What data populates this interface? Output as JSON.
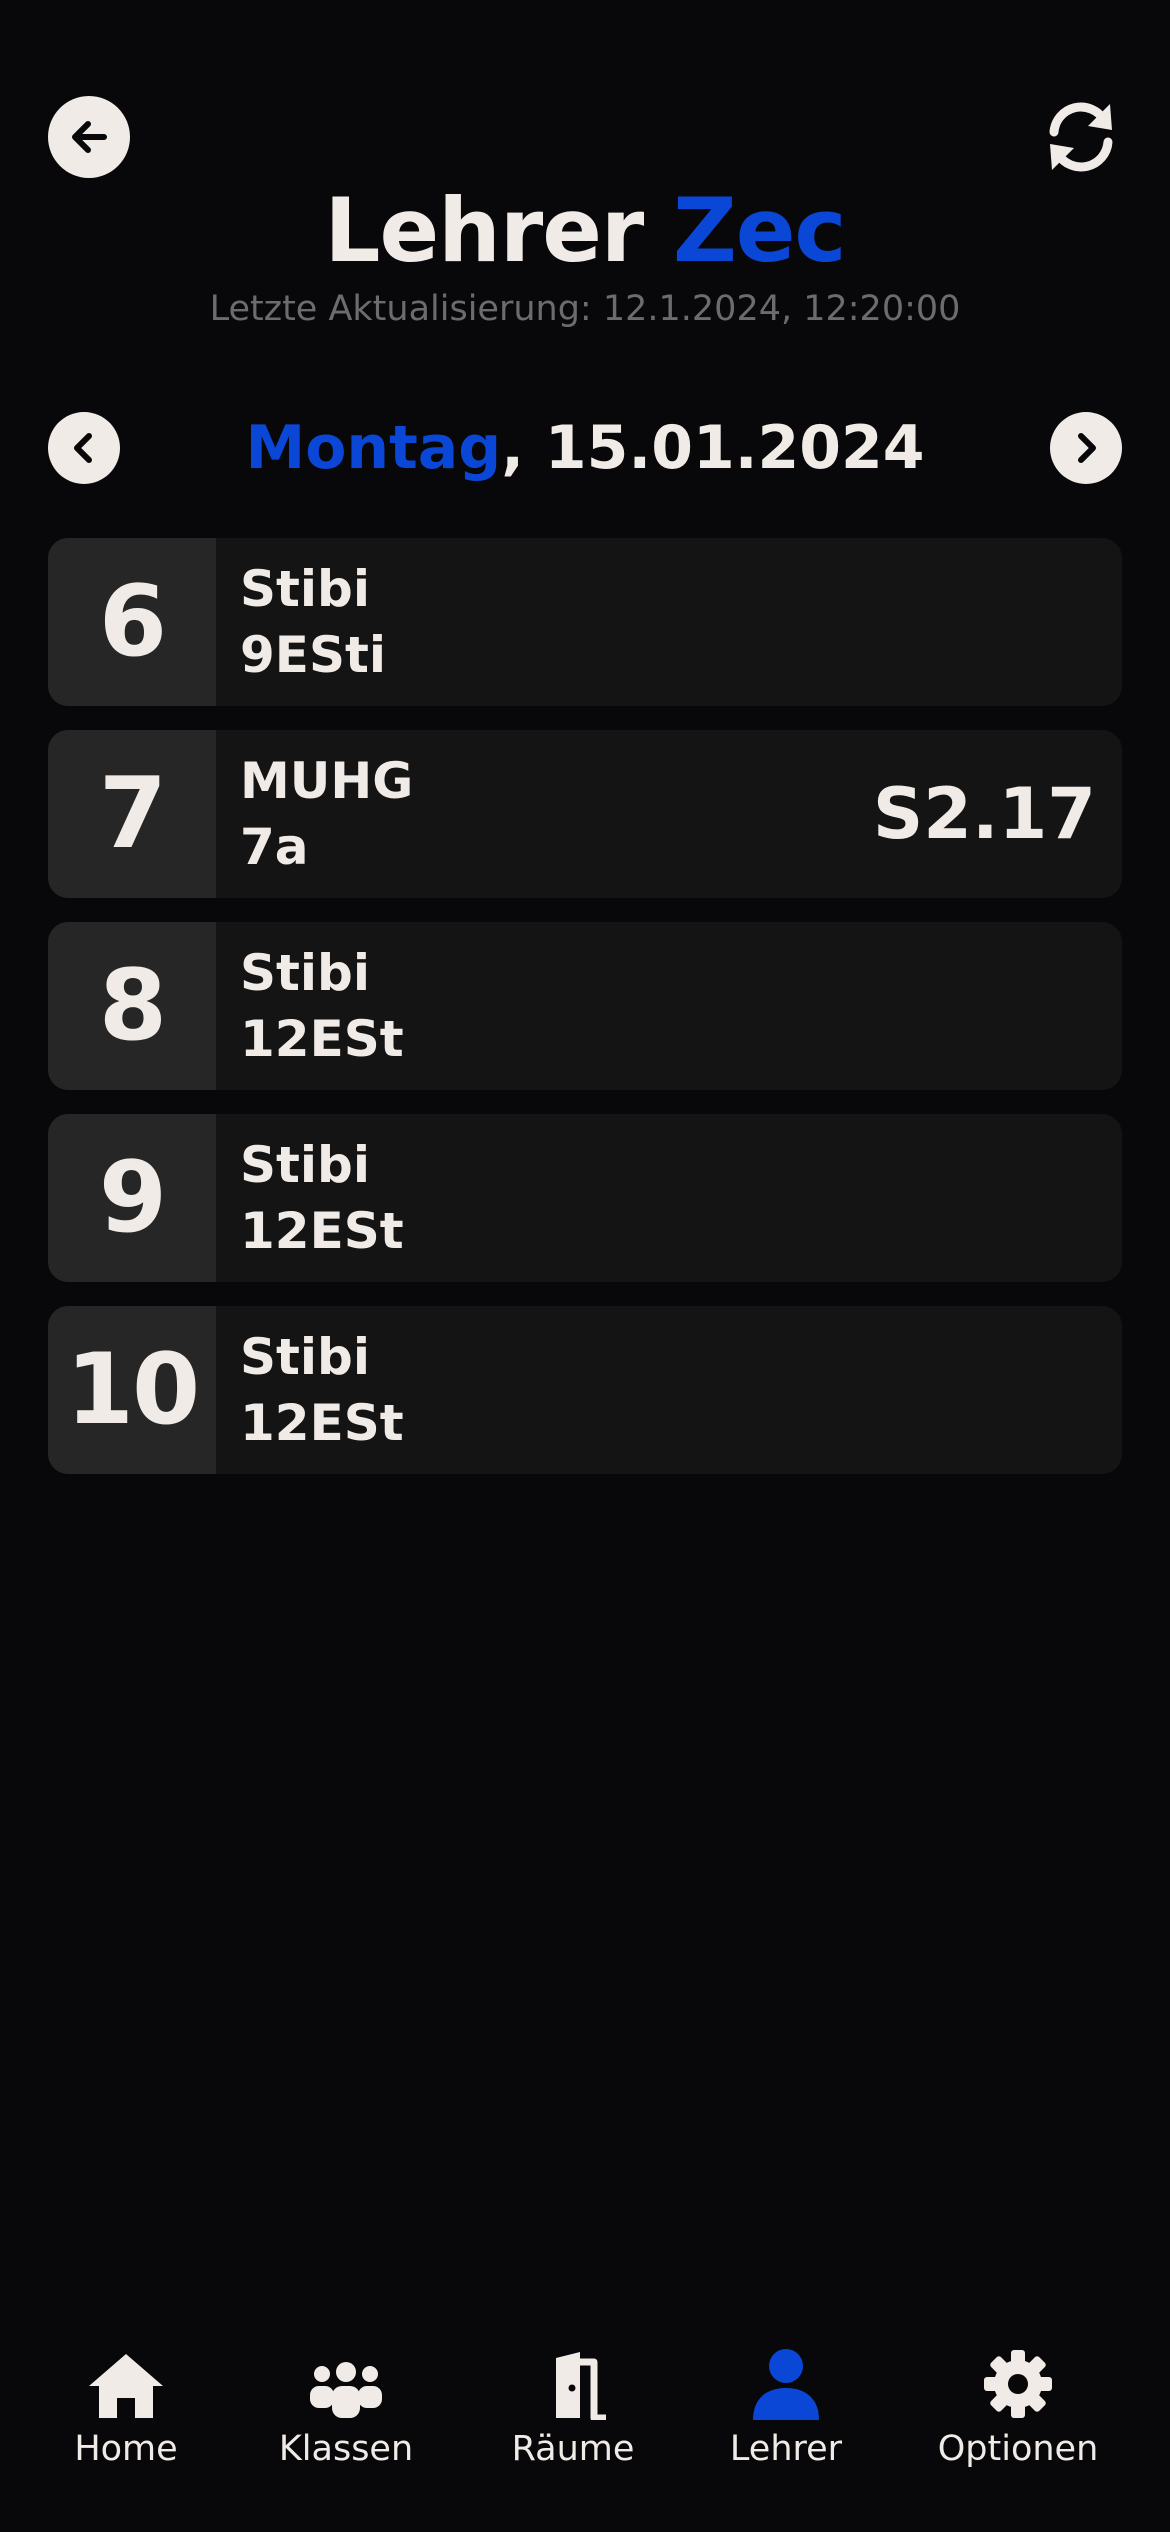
{
  "header": {
    "title_prefix": "Lehrer ",
    "title_name": "Zec",
    "last_update": "Letzte Aktualisierung: 12.1.2024, 12:20:00"
  },
  "day": {
    "weekday": "Montag",
    "date": ", 15.01.2024"
  },
  "lessons": [
    {
      "period": "6",
      "subject": "Stibi",
      "group": "9ESti",
      "room": ""
    },
    {
      "period": "7",
      "subject": "MUHG",
      "group": "7a",
      "room": "S2.17"
    },
    {
      "period": "8",
      "subject": "Stibi",
      "group": "12ESt",
      "room": ""
    },
    {
      "period": "9",
      "subject": "Stibi",
      "group": "12ESt",
      "room": ""
    },
    {
      "period": "10",
      "subject": "Stibi",
      "group": "12ESt",
      "room": ""
    }
  ],
  "nav": {
    "items": [
      {
        "label": "Home",
        "icon": "home-icon"
      },
      {
        "label": "Klassen",
        "icon": "users-icon"
      },
      {
        "label": "Räume",
        "icon": "door-icon"
      },
      {
        "label": "Lehrer",
        "icon": "user-icon",
        "active": true
      },
      {
        "label": "Optionen",
        "icon": "gear-icon"
      }
    ]
  },
  "colors": {
    "background": "#08080a",
    "accent": "#0a47d6",
    "text": "#f0ebe6",
    "card": "#141414",
    "period_cell": "#262626",
    "muted": "#6b6b70"
  }
}
